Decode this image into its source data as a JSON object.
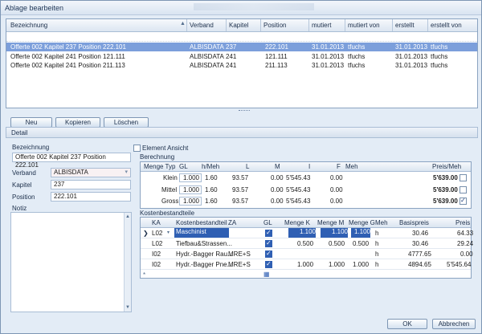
{
  "window": {
    "title": "Ablage bearbeiten"
  },
  "list": {
    "columns": [
      "Bezeichnung",
      "Verband",
      "Kapitel",
      "Position",
      "mutiert",
      "mutiert von",
      "erstellt",
      "erstellt von"
    ],
    "rows": [
      [
        "Offerte 002 Kapitel 237 Position 222.101",
        "ALBISDATA",
        "237",
        "222.101",
        "31.01.2013",
        "tfuchs",
        "31.01.2013",
        "tfuchs"
      ],
      [
        "Offerte 002 Kapitel 241 Position 121.111",
        "ALBISDATA",
        "241",
        "121.111",
        "31.01.2013",
        "tfuchs",
        "31.01.2013",
        "tfuchs"
      ],
      [
        "Offerte 002 Kapitel 241 Position 211.113",
        "ALBISDATA",
        "241",
        "211.113",
        "31.01.2013",
        "tfuchs",
        "31.01.2013",
        "tfuchs"
      ]
    ]
  },
  "actions": {
    "neu": "Neu",
    "kopieren": "Kopieren",
    "loeschen": "Löschen"
  },
  "detail": {
    "tab": "Detail",
    "bezeichnung_label": "Bezeichnung",
    "bezeichnung_value": "Offerte 002 Kapitel 237 Position 222.101",
    "verband_label": "Verband",
    "verband_value": "ALBISDATA",
    "kapitel_label": "Kapitel",
    "kapitel_value": "237",
    "position_label": "Position",
    "position_value": "222.101",
    "notiz_label": "Notiz",
    "element_ansicht": "Element Ansicht"
  },
  "berechnung": {
    "title": "Berechnung",
    "columns": [
      "Menge Typ",
      "GL",
      "h/Meh",
      "L",
      "M",
      "I",
      "F",
      "Meh",
      "Preis/Meh"
    ],
    "rows": [
      {
        "typ": "Klein",
        "gl": "1.000",
        "hmeh": "1.60",
        "l": "93.57",
        "m": "0.00",
        "i": "5'545.43",
        "f": "0.00",
        "meh": "",
        "preis": "5'639.00",
        "checked": false
      },
      {
        "typ": "Mittel",
        "gl": "1.000",
        "hmeh": "1.60",
        "l": "93.57",
        "m": "0.00",
        "i": "5'545.43",
        "f": "0.00",
        "meh": "",
        "preis": "5'639.00",
        "checked": false
      },
      {
        "typ": "Gross",
        "gl": "1.000",
        "hmeh": "1.60",
        "l": "93.57",
        "m": "0.00",
        "i": "5'545.43",
        "f": "0.00",
        "meh": "",
        "preis": "5'639.00",
        "checked": true
      }
    ]
  },
  "kosten": {
    "title": "Kostenbestandteile",
    "columns": [
      "KA",
      "Kostenbestandteil",
      "ZA",
      "GL",
      "Menge K",
      "Menge M",
      "Menge G",
      "Meh",
      "Basispreis",
      "Preis"
    ],
    "rows": [
      {
        "ka": "L02",
        "name": "Maschinist",
        "za": "",
        "gl": true,
        "mk": "1.100",
        "mm": "1.100",
        "mg": "1.100",
        "meh": "h",
        "basis": "30.46",
        "preis": "64.33"
      },
      {
        "ka": "L02",
        "name": "Tiefbau&Strassen...",
        "za": "",
        "gl": true,
        "mk": "0.500",
        "mm": "0.500",
        "mg": "0.500",
        "meh": "h",
        "basis": "30.46",
        "preis": "29.24"
      },
      {
        "ka": "I02",
        "name": "Hydr.-Bagger Rau...",
        "za": "MRE+S",
        "gl": true,
        "mk": "",
        "mm": "",
        "mg": "",
        "meh": "h",
        "basis": "4777.65",
        "preis": "0.00"
      },
      {
        "ka": "I02",
        "name": "Hydr.-Bagger Pne...",
        "za": "MRE+S",
        "gl": true,
        "mk": "1.000",
        "mm": "1.000",
        "mg": "1.000",
        "meh": "h",
        "basis": "4894.65",
        "preis": "5'545.64"
      }
    ]
  },
  "footer": {
    "ok": "OK",
    "cancel": "Abbrechen"
  }
}
